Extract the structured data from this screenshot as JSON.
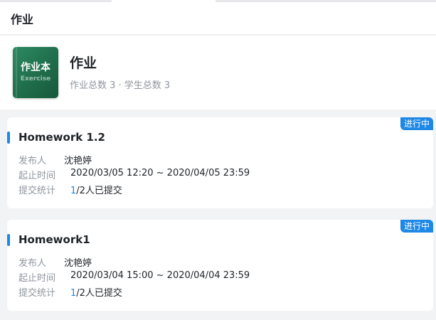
{
  "header": {
    "title": "作业"
  },
  "summary": {
    "cover_title": "作业本",
    "cover_subtitle": "Exercise",
    "name": "作业",
    "stats": "作业总数 3 · 学生总数 3"
  },
  "labels": {
    "publisher": "发布人",
    "period": "起止时间",
    "submission": "提交统计"
  },
  "homeworks": [
    {
      "title": "Homework 1.2",
      "status": "进行中",
      "publisher": "沈艳婷",
      "period": "2020/03/05 12:20 ~ 2020/04/05 23:59",
      "submitted": "1",
      "submitted_suffix": "/2人已提交"
    },
    {
      "title": "Homework1",
      "status": "进行中",
      "publisher": "沈艳婷",
      "period": "2020/03/04 15:00 ~ 2020/04/04 23:59",
      "submitted": "1",
      "submitted_suffix": "/2人已提交"
    }
  ],
  "colors": {
    "accent": "#1e88e5",
    "cover": "#1f6d4b",
    "muted_text": "#8f959e"
  }
}
